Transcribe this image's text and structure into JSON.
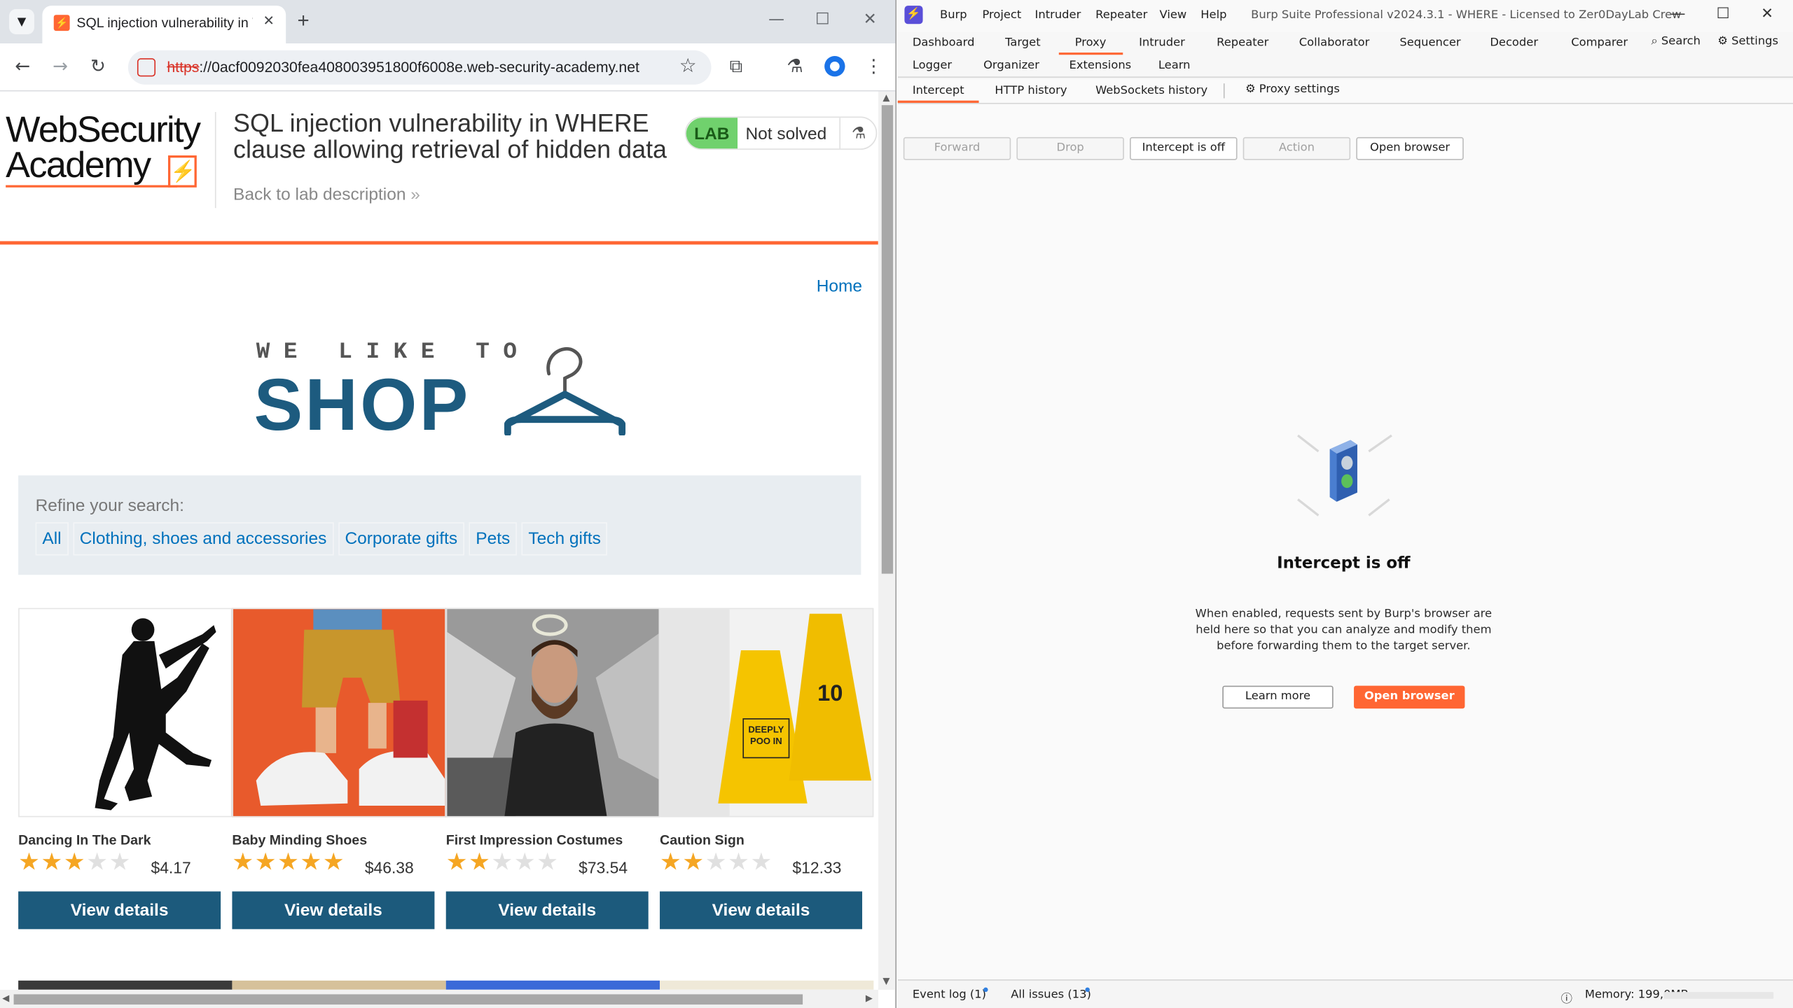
{
  "browser": {
    "tab_title": "SQL injection vulnerability in WHERE",
    "tab_favicon": "⚡",
    "url_scheme": "https",
    "url_rest": "://0acf0092030fea408003951800f6008e.web-security-academy.net"
  },
  "lab_header": {
    "logo_line1": "WebSecurity",
    "logo_line2": "Academy",
    "logo_mark": "⚡",
    "title": "SQL injection vulnerability in WHERE clause allowing retrieval of hidden data",
    "back_link": "Back to lab description",
    "back_chevrons": "»",
    "badge_lab": "LAB",
    "badge_status": "Not solved",
    "badge_icon": "⚗"
  },
  "shop": {
    "home_link": "Home",
    "logo_small": "WE LIKE TO",
    "logo_big": "SHOP",
    "refine_label": "Refine your search:",
    "filters": [
      "All",
      "Clothing, shoes and accessories",
      "Corporate gifts",
      "Pets",
      "Tech gifts"
    ],
    "products": [
      {
        "name": "Dancing In The Dark",
        "price": "$4.17",
        "rating": 3,
        "button": "View details",
        "image": "zombie-silhouette"
      },
      {
        "name": "Baby Minding Shoes",
        "price": "$46.38",
        "rating": 5,
        "button": "View details",
        "image": "shoes-on-orange"
      },
      {
        "name": "First Impression Costumes",
        "price": "$73.54",
        "rating": 2,
        "button": "View details",
        "image": "bearded-man-angel"
      },
      {
        "name": "Caution Sign",
        "price": "$12.33",
        "rating": 2,
        "button": "View details",
        "image": "yellow-caution-signs"
      }
    ]
  },
  "burp": {
    "menu": [
      "Burp",
      "Project",
      "Intruder",
      "Repeater",
      "View",
      "Help"
    ],
    "title": "Burp Suite Professional v2024.3.1 - WHERE - Licensed to Zer0DayLab Crew",
    "tabs_row1": [
      "Dashboard",
      "Target",
      "Proxy",
      "Intruder",
      "Repeater",
      "Collaborator",
      "Sequencer",
      "Decoder",
      "Comparer"
    ],
    "tabs_row2": [
      "Logger",
      "Organizer",
      "Extensions",
      "Learn"
    ],
    "search_label": "Search",
    "settings_label": "Settings",
    "active_tab": "Proxy",
    "subtabs": [
      "Intercept",
      "HTTP history",
      "WebSockets history"
    ],
    "proxy_settings": "Proxy settings",
    "buttons": {
      "forward": "Forward",
      "drop": "Drop",
      "intercept": "Intercept is off",
      "action": "Action",
      "open_browser": "Open browser"
    },
    "center_title": "Intercept is off",
    "center_desc": "When enabled, requests sent by Burp's browser are held here so that you can analyze and modify them before forwarding them to the target server.",
    "learn_more": "Learn more",
    "open_browser_cta": "Open browser",
    "status": {
      "event_log": "Event log (1)",
      "all_issues": "All issues (13)",
      "memory": "Memory: 199,0MB"
    }
  },
  "colors": {
    "brand_orange": "#ff6633",
    "shop_blue": "#1c5a7c",
    "link_blue": "#0071bc",
    "star": "#f5a623",
    "lab_green": "#70d16d"
  }
}
